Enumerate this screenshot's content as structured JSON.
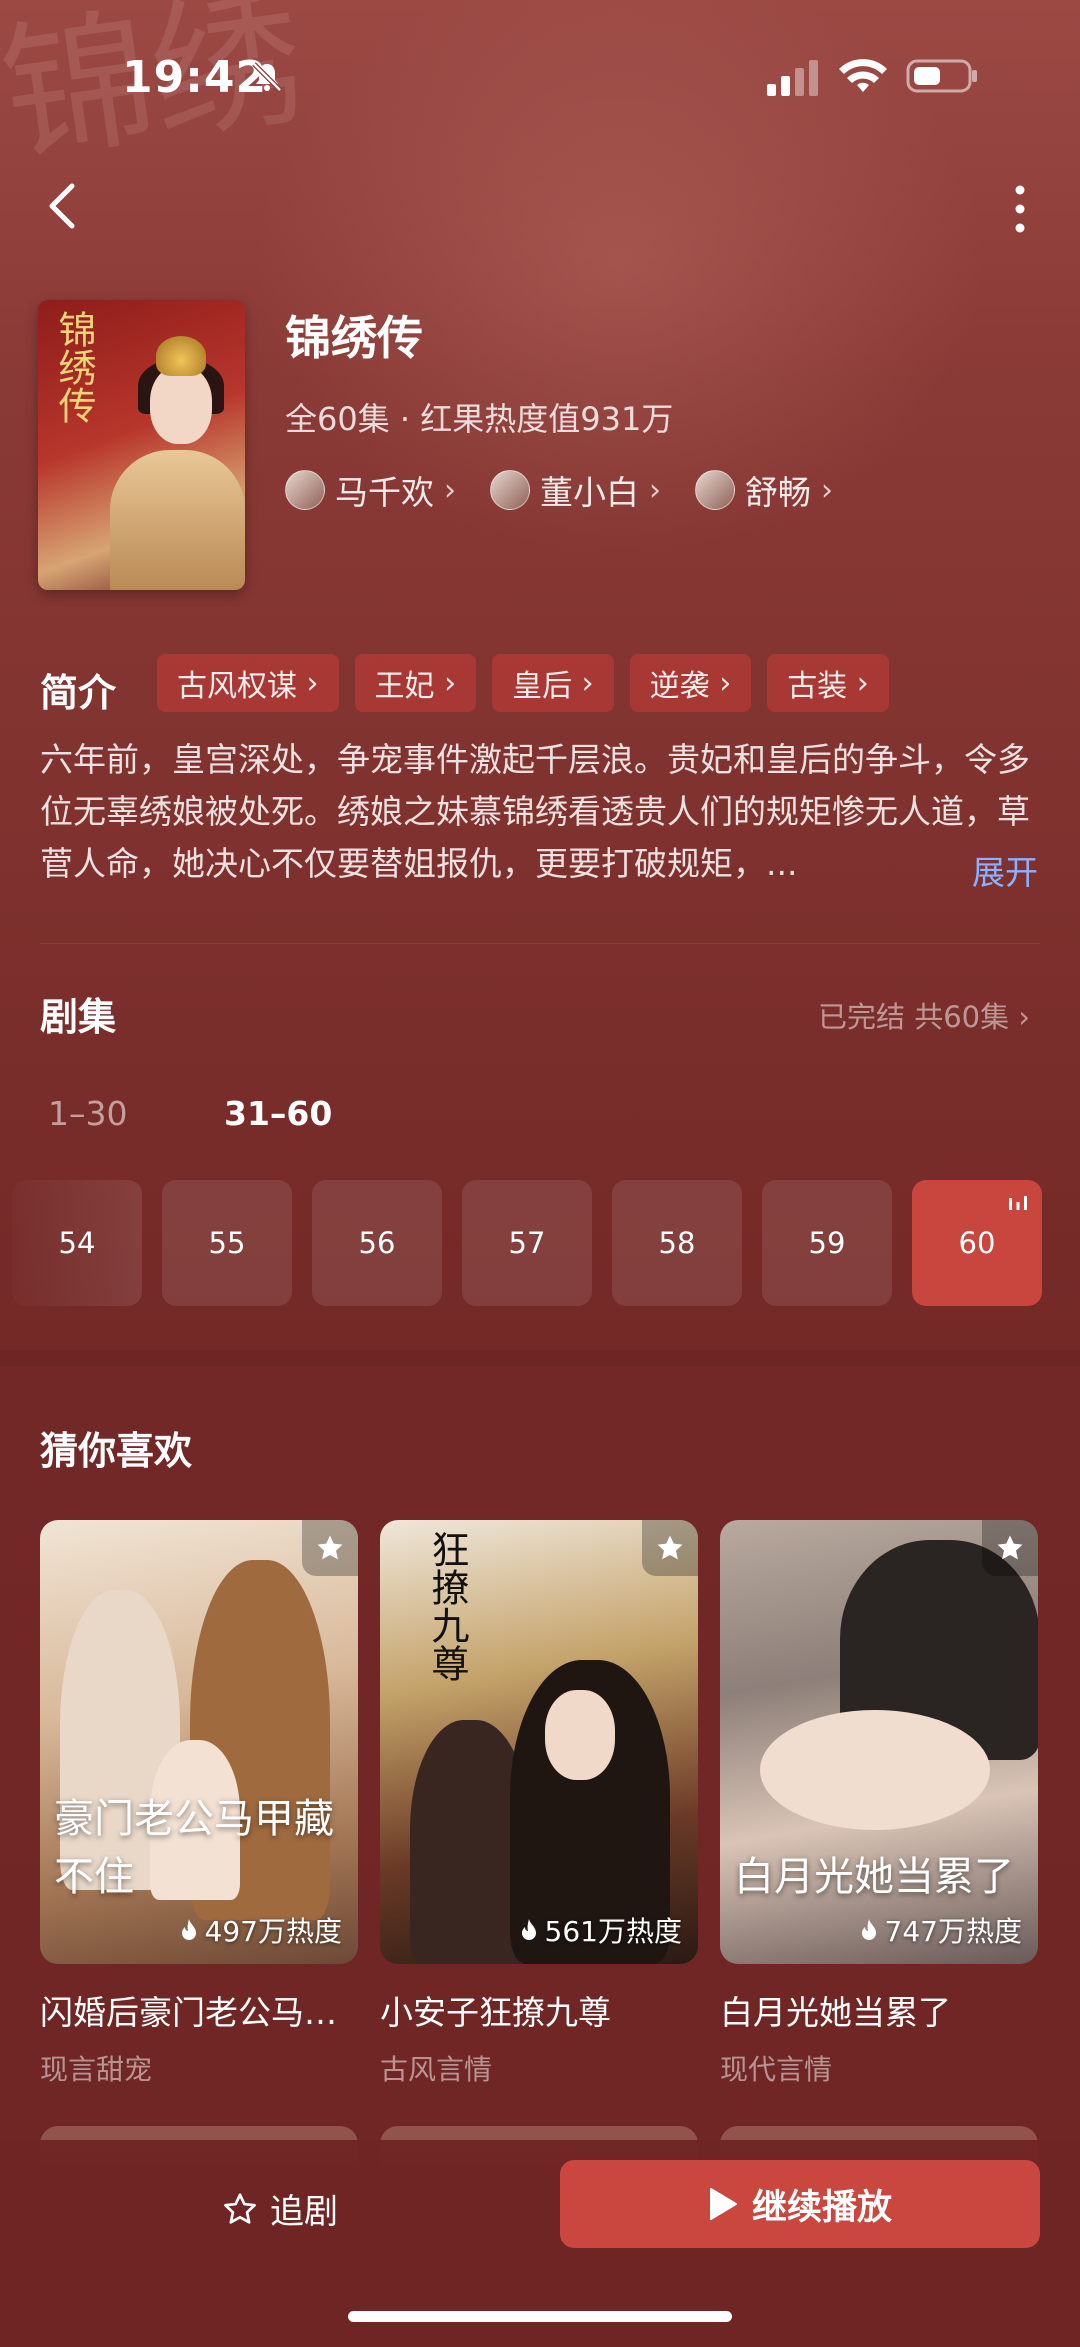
{
  "status_bar": {
    "time": "19:42"
  },
  "show": {
    "title": "锦绣传",
    "meta": "全60集 · 红果热度值931万",
    "poster_title": "锦绣传",
    "cast": [
      {
        "name": "马千欢"
      },
      {
        "name": "董小白"
      },
      {
        "name": "舒畅"
      }
    ]
  },
  "intro": {
    "label": "简介",
    "tags": [
      "古风权谋",
      "王妃",
      "皇后",
      "逆袭",
      "古装"
    ],
    "description": "六年前，皇宫深处，争宠事件激起千层浪。贵妃和皇后的争斗，令多位无辜绣娘被处死。绣娘之妹慕锦绣看透贵人们的规矩惨无人道，草菅人命，她决心不仅要替姐报仇，更要打破规矩，...",
    "expand_label": "展开"
  },
  "episodes": {
    "label": "剧集",
    "status": "已完结 共60集",
    "ranges": [
      "1–30",
      "31–60"
    ],
    "selected_range": "31–60",
    "items": [
      "54",
      "55",
      "56",
      "57",
      "58",
      "59",
      "60"
    ],
    "current": "60"
  },
  "recommend": {
    "label": "猜你喜欢",
    "cards": [
      {
        "title": "闪婚后豪门老公马甲藏不住了",
        "genre": "现言甜宠",
        "heat": "497万热度",
        "cover_text": "豪门老公马甲藏不住"
      },
      {
        "title": "小安子狂撩九尊",
        "genre": "古风言情",
        "heat": "561万热度",
        "cover_text": "狂撩九尊"
      },
      {
        "title": "白月光她当累了",
        "genre": "现代言情",
        "heat": "747万热度",
        "cover_text": "白月光她当累了"
      }
    ]
  },
  "bottom_bar": {
    "follow_label": "追剧",
    "play_label": "继续播放"
  },
  "colors": {
    "accent": "#c9473f",
    "link": "#8fb0ff",
    "background": "#7a2a28"
  },
  "icons": [
    "back-icon",
    "more-icon",
    "bell-muted-icon",
    "signal-icon",
    "wifi-icon",
    "battery-icon",
    "star-icon",
    "flame-icon",
    "play-icon"
  ]
}
